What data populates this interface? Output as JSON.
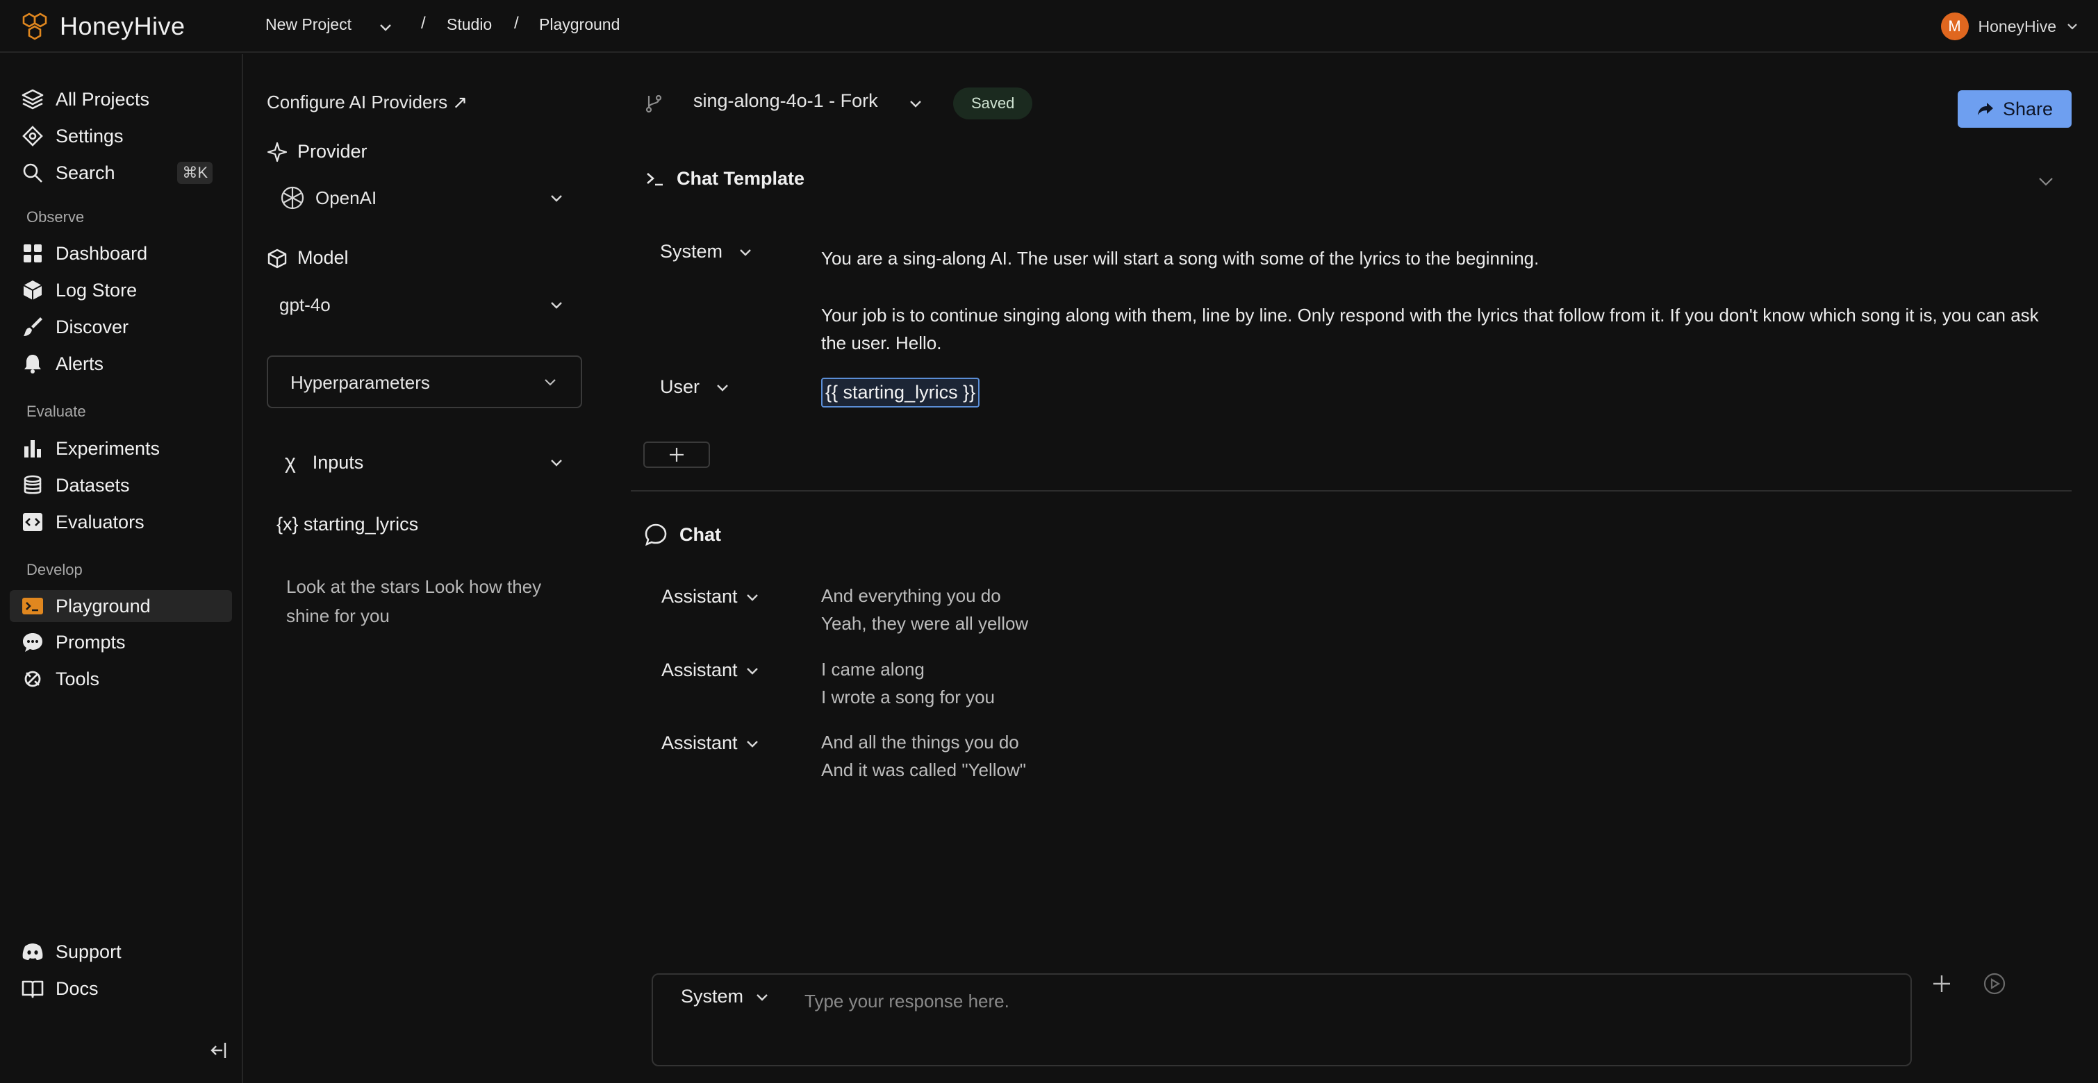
{
  "brand": {
    "name": "HoneyHive",
    "accent": "#e0871f"
  },
  "breadcrumb": {
    "project": "New Project",
    "sep": "/",
    "studio": "Studio",
    "playground": "Playground"
  },
  "user": {
    "initial": "M",
    "name": "HoneyHive"
  },
  "sidebar": {
    "top_items": [
      {
        "label": "All Projects",
        "icon": "layers-icon"
      },
      {
        "label": "Settings",
        "icon": "gear-icon"
      },
      {
        "label": "Search",
        "icon": "search-icon",
        "shortcut": "⌘K"
      }
    ],
    "observe": {
      "title": "Observe",
      "items": [
        {
          "label": "Dashboard",
          "icon": "grid-icon"
        },
        {
          "label": "Log Store",
          "icon": "cube-icon"
        },
        {
          "label": "Discover",
          "icon": "brush-icon"
        },
        {
          "label": "Alerts",
          "icon": "bell-icon"
        }
      ]
    },
    "evaluate": {
      "title": "Evaluate",
      "items": [
        {
          "label": "Experiments",
          "icon": "bar-chart-icon"
        },
        {
          "label": "Datasets",
          "icon": "database-icon"
        },
        {
          "label": "Evaluators",
          "icon": "code-icon"
        }
      ]
    },
    "develop": {
      "title": "Develop",
      "items": [
        {
          "label": "Playground",
          "icon": "terminal-icon",
          "active": true
        },
        {
          "label": "Prompts",
          "icon": "chat-icon"
        },
        {
          "label": "Tools",
          "icon": "tools-icon"
        }
      ]
    },
    "bottom": [
      {
        "label": "Support",
        "icon": "discord-icon"
      },
      {
        "label": "Docs",
        "icon": "book-icon"
      }
    ]
  },
  "config": {
    "providers_link": "Configure AI Providers ↗",
    "provider_heading": "Provider",
    "provider_value": "OpenAI",
    "model_heading": "Model",
    "model_value": "gpt-4o",
    "hyperparameters": "Hyperparameters",
    "inputs_heading": "Inputs",
    "inputs_symbol": "χ",
    "input_var": "{x} starting_lyrics",
    "input_value": "Look at the stars Look how they shine for you"
  },
  "main": {
    "prompt_name": "sing-along-4o-1 - Fork",
    "status": "Saved",
    "share": "Share",
    "template_title": "Chat Template",
    "template": [
      {
        "role": "System",
        "lines": [
          "You are a sing-along AI. The user will start a song with some of the lyrics to the beginning.",
          "Your job is to continue singing along with them, line by line. Only respond with the lyrics that follow from it. If you don't know which song it is, you can ask the user. Hello."
        ]
      },
      {
        "role": "User",
        "var": "{{ starting_lyrics }}"
      }
    ],
    "chat_title": "Chat",
    "chat": [
      {
        "role": "Assistant",
        "text1": "And everything you do",
        "text2": "Yeah, they were all yellow"
      },
      {
        "role": "Assistant",
        "text1": "I came along",
        "text2": "I wrote a song for you"
      },
      {
        "role": "Assistant",
        "text1": "And all the things you do",
        "text2": "And it was called \"Yellow\""
      }
    ],
    "composer": {
      "role": "System",
      "placeholder": "Type your response here."
    }
  }
}
